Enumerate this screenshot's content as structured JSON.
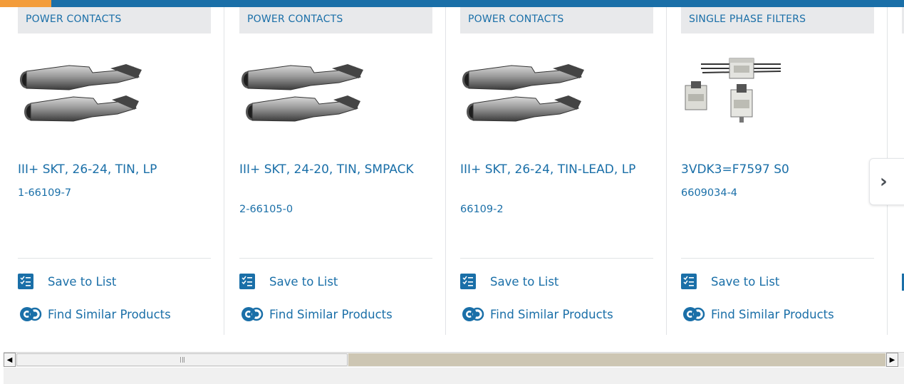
{
  "colors": {
    "brand_blue": "#1a6fa8",
    "accent_orange": "#f39c3a",
    "tag_background": "#e8e9eb"
  },
  "actions": {
    "save_label": "Save to List",
    "similar_label": "Find Similar Products"
  },
  "carousel": {
    "next_arrow": "›",
    "products": [
      {
        "category": "POWER CONTACTS",
        "name": "III+ SKT, 26-24, TIN, LP",
        "part_number": "1-66109-7",
        "image": "power-contact-pins"
      },
      {
        "category": "POWER CONTACTS",
        "name": "III+ SKT, 24-20, TIN, SMPACK",
        "part_number": "2-66105-0",
        "image": "power-contact-pins"
      },
      {
        "category": "POWER CONTACTS",
        "name": "III+ SKT, 26-24, TIN-LEAD, LP",
        "part_number": "66109-2",
        "image": "power-contact-pins"
      },
      {
        "category": "SINGLE PHASE FILTERS",
        "name": "3VDK3=F7597 S0",
        "part_number": "6609034-4",
        "image": "single-phase-filters"
      }
    ]
  },
  "scrollbar": {
    "left_arrow": "◀",
    "right_arrow": "▶"
  }
}
